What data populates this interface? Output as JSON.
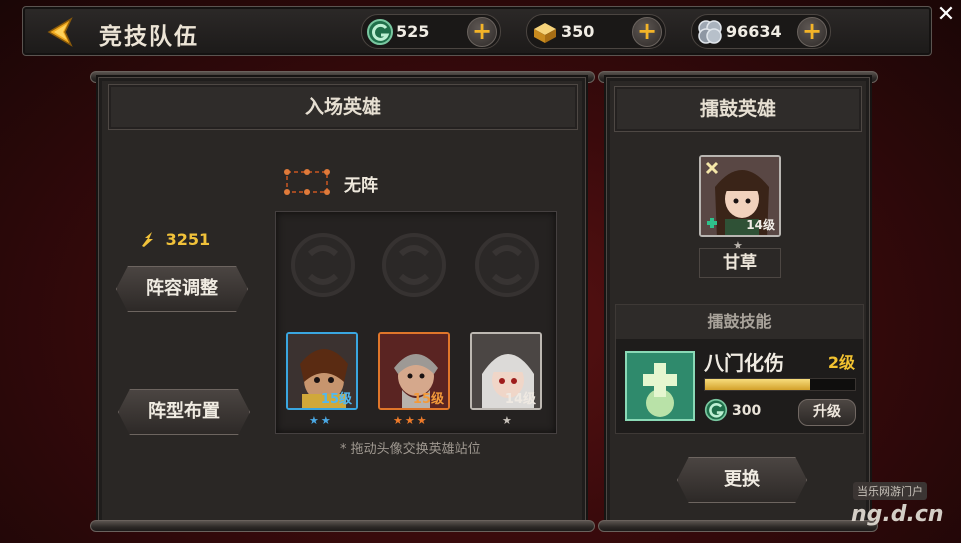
{
  "header": {
    "title": "竞技队伍",
    "resources": [
      {
        "icon": "swirl-coin-icon",
        "value": "525"
      },
      {
        "icon": "gold-ingot-icon",
        "value": "350"
      },
      {
        "icon": "silver-coin-icon",
        "value": "96634"
      }
    ]
  },
  "lineup": {
    "title": "入场英雄",
    "formation": "无阵",
    "power": "3251",
    "adjust_button": "阵容调整",
    "formation_button": "阵型布置",
    "heroes": [
      {
        "level": "15级",
        "stars": 2,
        "frame_color": "#3aa6e0",
        "star_color": "#4aa9e6",
        "level_color": "#52b8f0"
      },
      {
        "level": "15级",
        "stars": 3,
        "frame_color": "#e0762a",
        "star_color": "#ee7b2a",
        "level_color": "#f39a3a"
      },
      {
        "level": "14级",
        "stars": 1,
        "frame_color": "#bdb8b2",
        "star_color": "#c9c3bc",
        "level_color": "#efe9e2"
      }
    ],
    "hint": "* 拖动头像交换英雄站位"
  },
  "drum": {
    "title": "擂鼓英雄",
    "hero_name": "甘草",
    "hero_level": "14级",
    "skill_section_title": "擂鼓技能",
    "skill_name": "八门化伤",
    "skill_level": "2级",
    "skill_progress": 0.7,
    "upgrade_cost": "300",
    "upgrade_button": "升级",
    "replace_button": "更换"
  },
  "watermark": {
    "name": "当乐网游门户",
    "url": "ng.d.cn"
  },
  "close_glyph": "✕"
}
